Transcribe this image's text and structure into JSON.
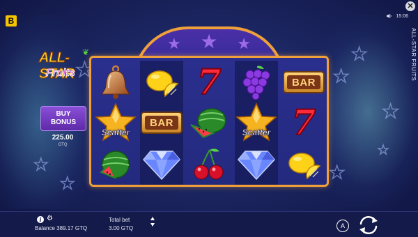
{
  "top_bar": {
    "brand_badge": "B",
    "time": "15:06",
    "game_title": "ALL-STAR FRUITS",
    "close_icon": "close-icon",
    "sound_icon": "speaker-icon"
  },
  "logo": {
    "line1": "ALL-STAR",
    "line2": "Fruits"
  },
  "buy_bonus": {
    "line1": "BUY",
    "line2": "BONUS",
    "price": "225.00",
    "currency": "GTQ"
  },
  "reels": {
    "symbols": [
      [
        "bell",
        "scatter",
        "watermelon"
      ],
      [
        "lemon",
        "bar",
        "diamond"
      ],
      [
        "seven",
        "watermelon",
        "cherries"
      ],
      [
        "grapes",
        "scatter",
        "diamond"
      ],
      [
        "bar",
        "seven",
        "lemon"
      ]
    ],
    "bar_text": "BAR",
    "scatter_text": "Scatter",
    "seven_text": "7"
  },
  "bottom_bar": {
    "balance_label": "Balance",
    "balance_value": "389.17 GTQ",
    "balance_text": "Balance 389.17 GTQ",
    "total_bet_label": "Total bet",
    "total_bet_value": "3.00 GTQ",
    "autoplay_label": "A"
  },
  "colors": {
    "background": "#1b2560",
    "reel_frame": "#f0a03a",
    "buy_bonus": "#7a3fd0",
    "seven": "#ff2a3a",
    "bottom_bar": "#141a4a"
  }
}
